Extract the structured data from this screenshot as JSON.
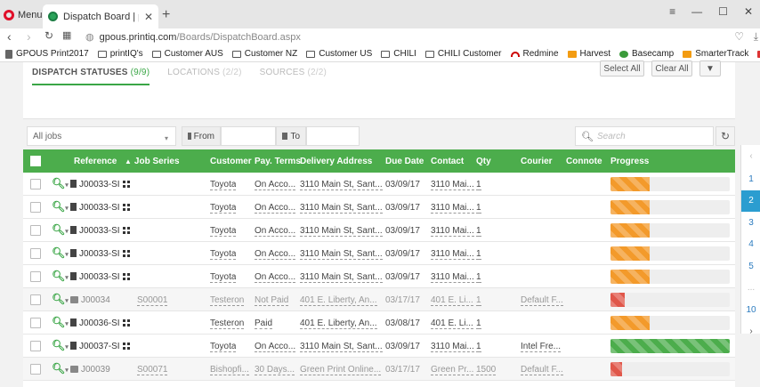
{
  "browser": {
    "menu_label": "Menu",
    "tab_title": "Dispatch Board | printIQ",
    "new_tab": "+",
    "url_host": "gpous.printiq.com",
    "url_path": "/Boards/DispatchBoard.aspx",
    "bookmarks": [
      {
        "label": "GPOUS Print2017",
        "icon": "doc"
      },
      {
        "label": "printIQ's",
        "icon": "folder"
      },
      {
        "label": "Customer AUS",
        "icon": "folder"
      },
      {
        "label": "Customer NZ",
        "icon": "folder"
      },
      {
        "label": "Customer US",
        "icon": "folder"
      },
      {
        "label": "CHILI",
        "icon": "folder"
      },
      {
        "label": "CHILI Customer",
        "icon": "folder"
      },
      {
        "label": "Redmine",
        "icon": "arc"
      },
      {
        "label": "Harvest",
        "icon": "orange"
      },
      {
        "label": "Basecamp",
        "icon": "green"
      },
      {
        "label": "SmarterTrack",
        "icon": "orange"
      },
      {
        "label": "Product Release Wor",
        "icon": "red"
      }
    ]
  },
  "status_tabs": [
    {
      "label": "DISPATCH STATUSES",
      "count": "(9/9)",
      "active": true
    },
    {
      "label": "LOCATIONS",
      "count": "(2/2)",
      "active": false
    },
    {
      "label": "SOURCES",
      "count": "(2/2)",
      "active": false
    }
  ],
  "buttons": {
    "select_all": "Select All",
    "clear_all": "Clear All"
  },
  "filters": {
    "jobs_select": "All jobs",
    "from_label": "From",
    "to_label": "To",
    "search_placeholder": "Search"
  },
  "columns": [
    "Reference",
    "Job Series",
    "Customer",
    "Pay. Terms",
    "Delivery Address",
    "Due Date",
    "Contact",
    "Qty",
    "Courier",
    "Connote",
    "Progress"
  ],
  "rows": [
    {
      "ref": "J00033-SI",
      "series": "",
      "customer": "Toyota",
      "terms": "On Acco...",
      "address": "3110 Main St, Sant...",
      "due": "03/09/17",
      "contact": "3110 Mai...",
      "qty": "1",
      "courier": "",
      "connote": "",
      "progress": 0.33,
      "color": "#f39a2b",
      "muted": false,
      "printer": false
    },
    {
      "ref": "J00033-SI",
      "series": "",
      "customer": "Toyota",
      "terms": "On Acco...",
      "address": "3110 Main St, Sant...",
      "due": "03/09/17",
      "contact": "3110 Mai...",
      "qty": "1",
      "courier": "",
      "connote": "",
      "progress": 0.33,
      "color": "#f39a2b",
      "muted": false,
      "printer": false
    },
    {
      "ref": "J00033-SI",
      "series": "",
      "customer": "Toyota",
      "terms": "On Acco...",
      "address": "3110 Main St, Sant...",
      "due": "03/09/17",
      "contact": "3110 Mai...",
      "qty": "1",
      "courier": "",
      "connote": "",
      "progress": 0.33,
      "color": "#f39a2b",
      "muted": false,
      "printer": false
    },
    {
      "ref": "J00033-SI",
      "series": "",
      "customer": "Toyota",
      "terms": "On Acco...",
      "address": "3110 Main St, Sant...",
      "due": "03/09/17",
      "contact": "3110 Mai...",
      "qty": "1",
      "courier": "",
      "connote": "",
      "progress": 0.33,
      "color": "#f39a2b",
      "muted": false,
      "printer": false
    },
    {
      "ref": "J00033-SI",
      "series": "",
      "customer": "Toyota",
      "terms": "On Acco...",
      "address": "3110 Main St, Sant...",
      "due": "03/09/17",
      "contact": "3110 Mai...",
      "qty": "1",
      "courier": "",
      "connote": "",
      "progress": 0.33,
      "color": "#f39a2b",
      "muted": false,
      "printer": false
    },
    {
      "ref": "J00034",
      "series": "S00001",
      "customer": "Testeron",
      "terms": "Not Paid",
      "address": "401 E. Liberty, An...",
      "due": "03/17/17",
      "contact": "401 E. Li...",
      "qty": "1",
      "courier": "Default F...",
      "connote": "",
      "progress": 0.12,
      "color": "#e0574a",
      "muted": true,
      "printer": true
    },
    {
      "ref": "J00036-SI",
      "series": "",
      "customer": "Testeron",
      "terms": "Paid",
      "address": "401 E. Liberty, An...",
      "due": "03/08/17",
      "contact": "401 E. Li...",
      "qty": "1",
      "courier": "",
      "connote": "",
      "progress": 0.33,
      "color": "#f39a2b",
      "muted": false,
      "printer": false
    },
    {
      "ref": "J00037-SI",
      "series": "",
      "customer": "Toyota",
      "terms": "On Acco...",
      "address": "3110 Main St, Sant...",
      "due": "03/09/17",
      "contact": "3110 Mai...",
      "qty": "1",
      "courier": "Intel Fre...",
      "connote": "",
      "progress": 1.0,
      "color": "#4cad4c",
      "muted": false,
      "printer": false
    },
    {
      "ref": "J00039",
      "series": "S00071",
      "customer": "Bishopfi...",
      "terms": "30 Days...",
      "address": "Green Print Online...",
      "due": "03/17/17",
      "contact": "Green Pr...",
      "qty": "1500",
      "courier": "Default F...",
      "connote": "",
      "progress": 0.1,
      "color": "#e0574a",
      "muted": true,
      "printer": true
    }
  ],
  "pager": [
    "1",
    "2",
    "3",
    "4",
    "5",
    "...",
    "10"
  ],
  "pager_active": "2",
  "accent": "#4cad4c"
}
